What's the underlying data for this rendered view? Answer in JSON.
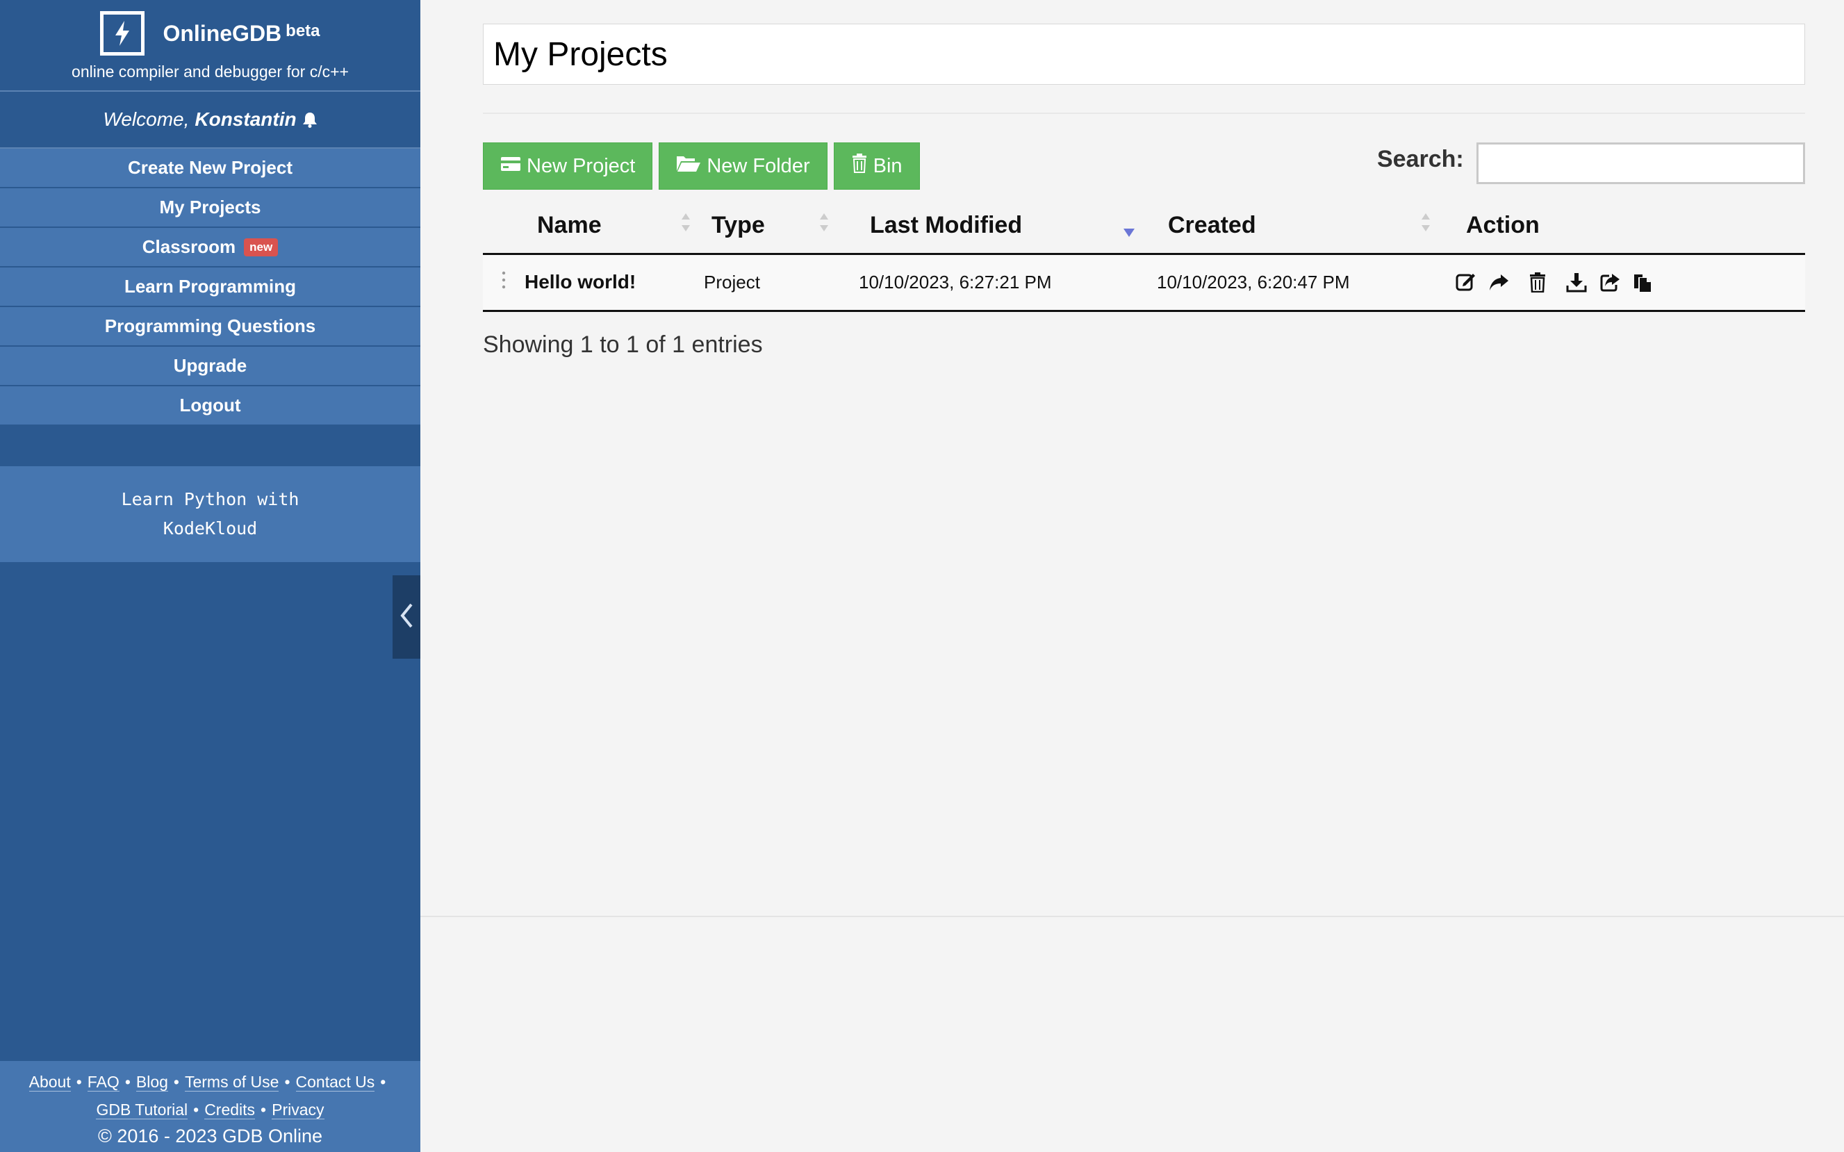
{
  "brand": {
    "name": "OnlineGDB",
    "beta": "beta",
    "tagline": "online compiler and debugger for c/c++"
  },
  "welcome": {
    "prefix": "Welcome,",
    "user": "Konstantin"
  },
  "nav": [
    {
      "label": "Create New Project"
    },
    {
      "label": "My Projects"
    },
    {
      "label": "Classroom",
      "badge": "new"
    },
    {
      "label": "Learn Programming"
    },
    {
      "label": "Programming Questions"
    },
    {
      "label": "Upgrade"
    },
    {
      "label": "Logout"
    }
  ],
  "promo": {
    "line1": "Learn Python with",
    "line2": "KodeKloud"
  },
  "footer": {
    "links_row1": [
      "About",
      "FAQ",
      "Blog",
      "Terms of Use",
      "Contact Us"
    ],
    "links_row2": [
      "GDB Tutorial",
      "Credits",
      "Privacy"
    ],
    "copyright": "© 2016 - 2023 GDB Online"
  },
  "main": {
    "title": "My Projects",
    "buttons": {
      "new_project": "New Project",
      "new_folder": "New Folder",
      "bin": "Bin"
    },
    "search_label": "Search:",
    "search_value": "",
    "columns": [
      "Name",
      "Type",
      "Last Modified",
      "Created",
      "Action"
    ],
    "sorted_column": "Last Modified",
    "rows": [
      {
        "name": "Hello world!",
        "type": "Project",
        "last_modified": "10/10/2023, 6:27:21 PM",
        "created": "10/10/2023, 6:20:47 PM",
        "actions": [
          "edit-icon",
          "share-icon",
          "trash-icon",
          "download-icon",
          "export-icon",
          "copy-icon"
        ]
      }
    ],
    "info": "Showing 1 to 1 of 1 entries"
  },
  "colors": {
    "sidebar": "#2b5990",
    "nav_item": "#4676b0",
    "button_green": "#5cb85c",
    "badge_red": "#d9534f",
    "sort_active": "#6b76d6"
  }
}
